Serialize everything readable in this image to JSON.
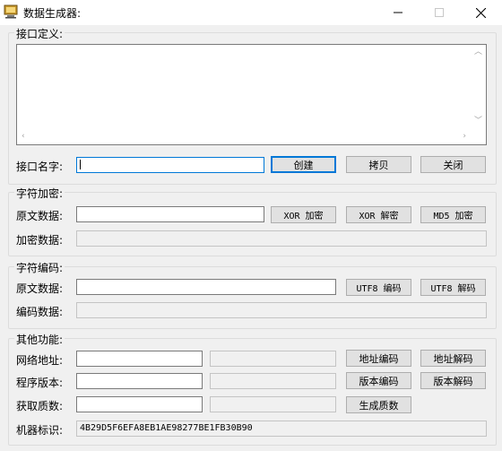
{
  "window": {
    "title": "数据生成器:",
    "app_icon": "computer-icon",
    "controls": [
      "minimize-icon",
      "maximize-icon",
      "close-icon"
    ]
  },
  "interface": {
    "group_label": "接口定义:",
    "definition_text": "",
    "name_label": "接口名字:",
    "name_value": "",
    "create_label": "创建",
    "copy_label": "拷贝",
    "close_label": "关闭"
  },
  "encrypt": {
    "group_label": "字符加密:",
    "source_label": "原文数据:",
    "source_value": "",
    "xor_encrypt_label": "XOR 加密",
    "xor_decrypt_label": "XOR 解密",
    "md5_encrypt_label": "MD5 加密",
    "result_label": "加密数据:",
    "result_value": ""
  },
  "encode": {
    "group_label": "字符编码:",
    "source_label": "原文数据:",
    "source_value": "",
    "utf8_encode_label": "UTF8 编码",
    "utf8_decode_label": "UTF8 解码",
    "result_label": "编码数据:",
    "result_value": ""
  },
  "other": {
    "group_label": "其他功能:",
    "url_label": "网络地址:",
    "url_value": "",
    "url_result": "",
    "url_encode_label": "地址编码",
    "url_decode_label": "地址解码",
    "version_label": "程序版本:",
    "version_value": "",
    "version_result": "",
    "version_encode_label": "版本编码",
    "version_decode_label": "版本解码",
    "prime_label": "获取质数:",
    "prime_value": "",
    "prime_result": "",
    "prime_generate_label": "生成质数",
    "machine_label": "机器标识:",
    "machine_value": "4B29D5F6EFA8EB1AE98277BE1FB30B90"
  }
}
